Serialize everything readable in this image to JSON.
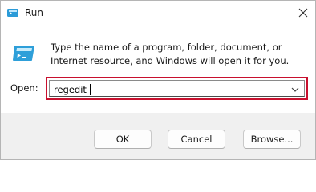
{
  "window": {
    "title": "Run",
    "app_icon": "run-icon",
    "close_icon": "close-icon"
  },
  "body": {
    "icon": "run-app-icon",
    "instructions": "Type the name of a program, folder, document, or Internet resource, and Windows will open it for you."
  },
  "open_field": {
    "label": "Open:",
    "value": "regedit",
    "dropdown_icon": "chevron-down-icon",
    "highlight_color": "#c8102e"
  },
  "buttons": {
    "ok": "OK",
    "cancel": "Cancel",
    "browse": "Browse..."
  }
}
